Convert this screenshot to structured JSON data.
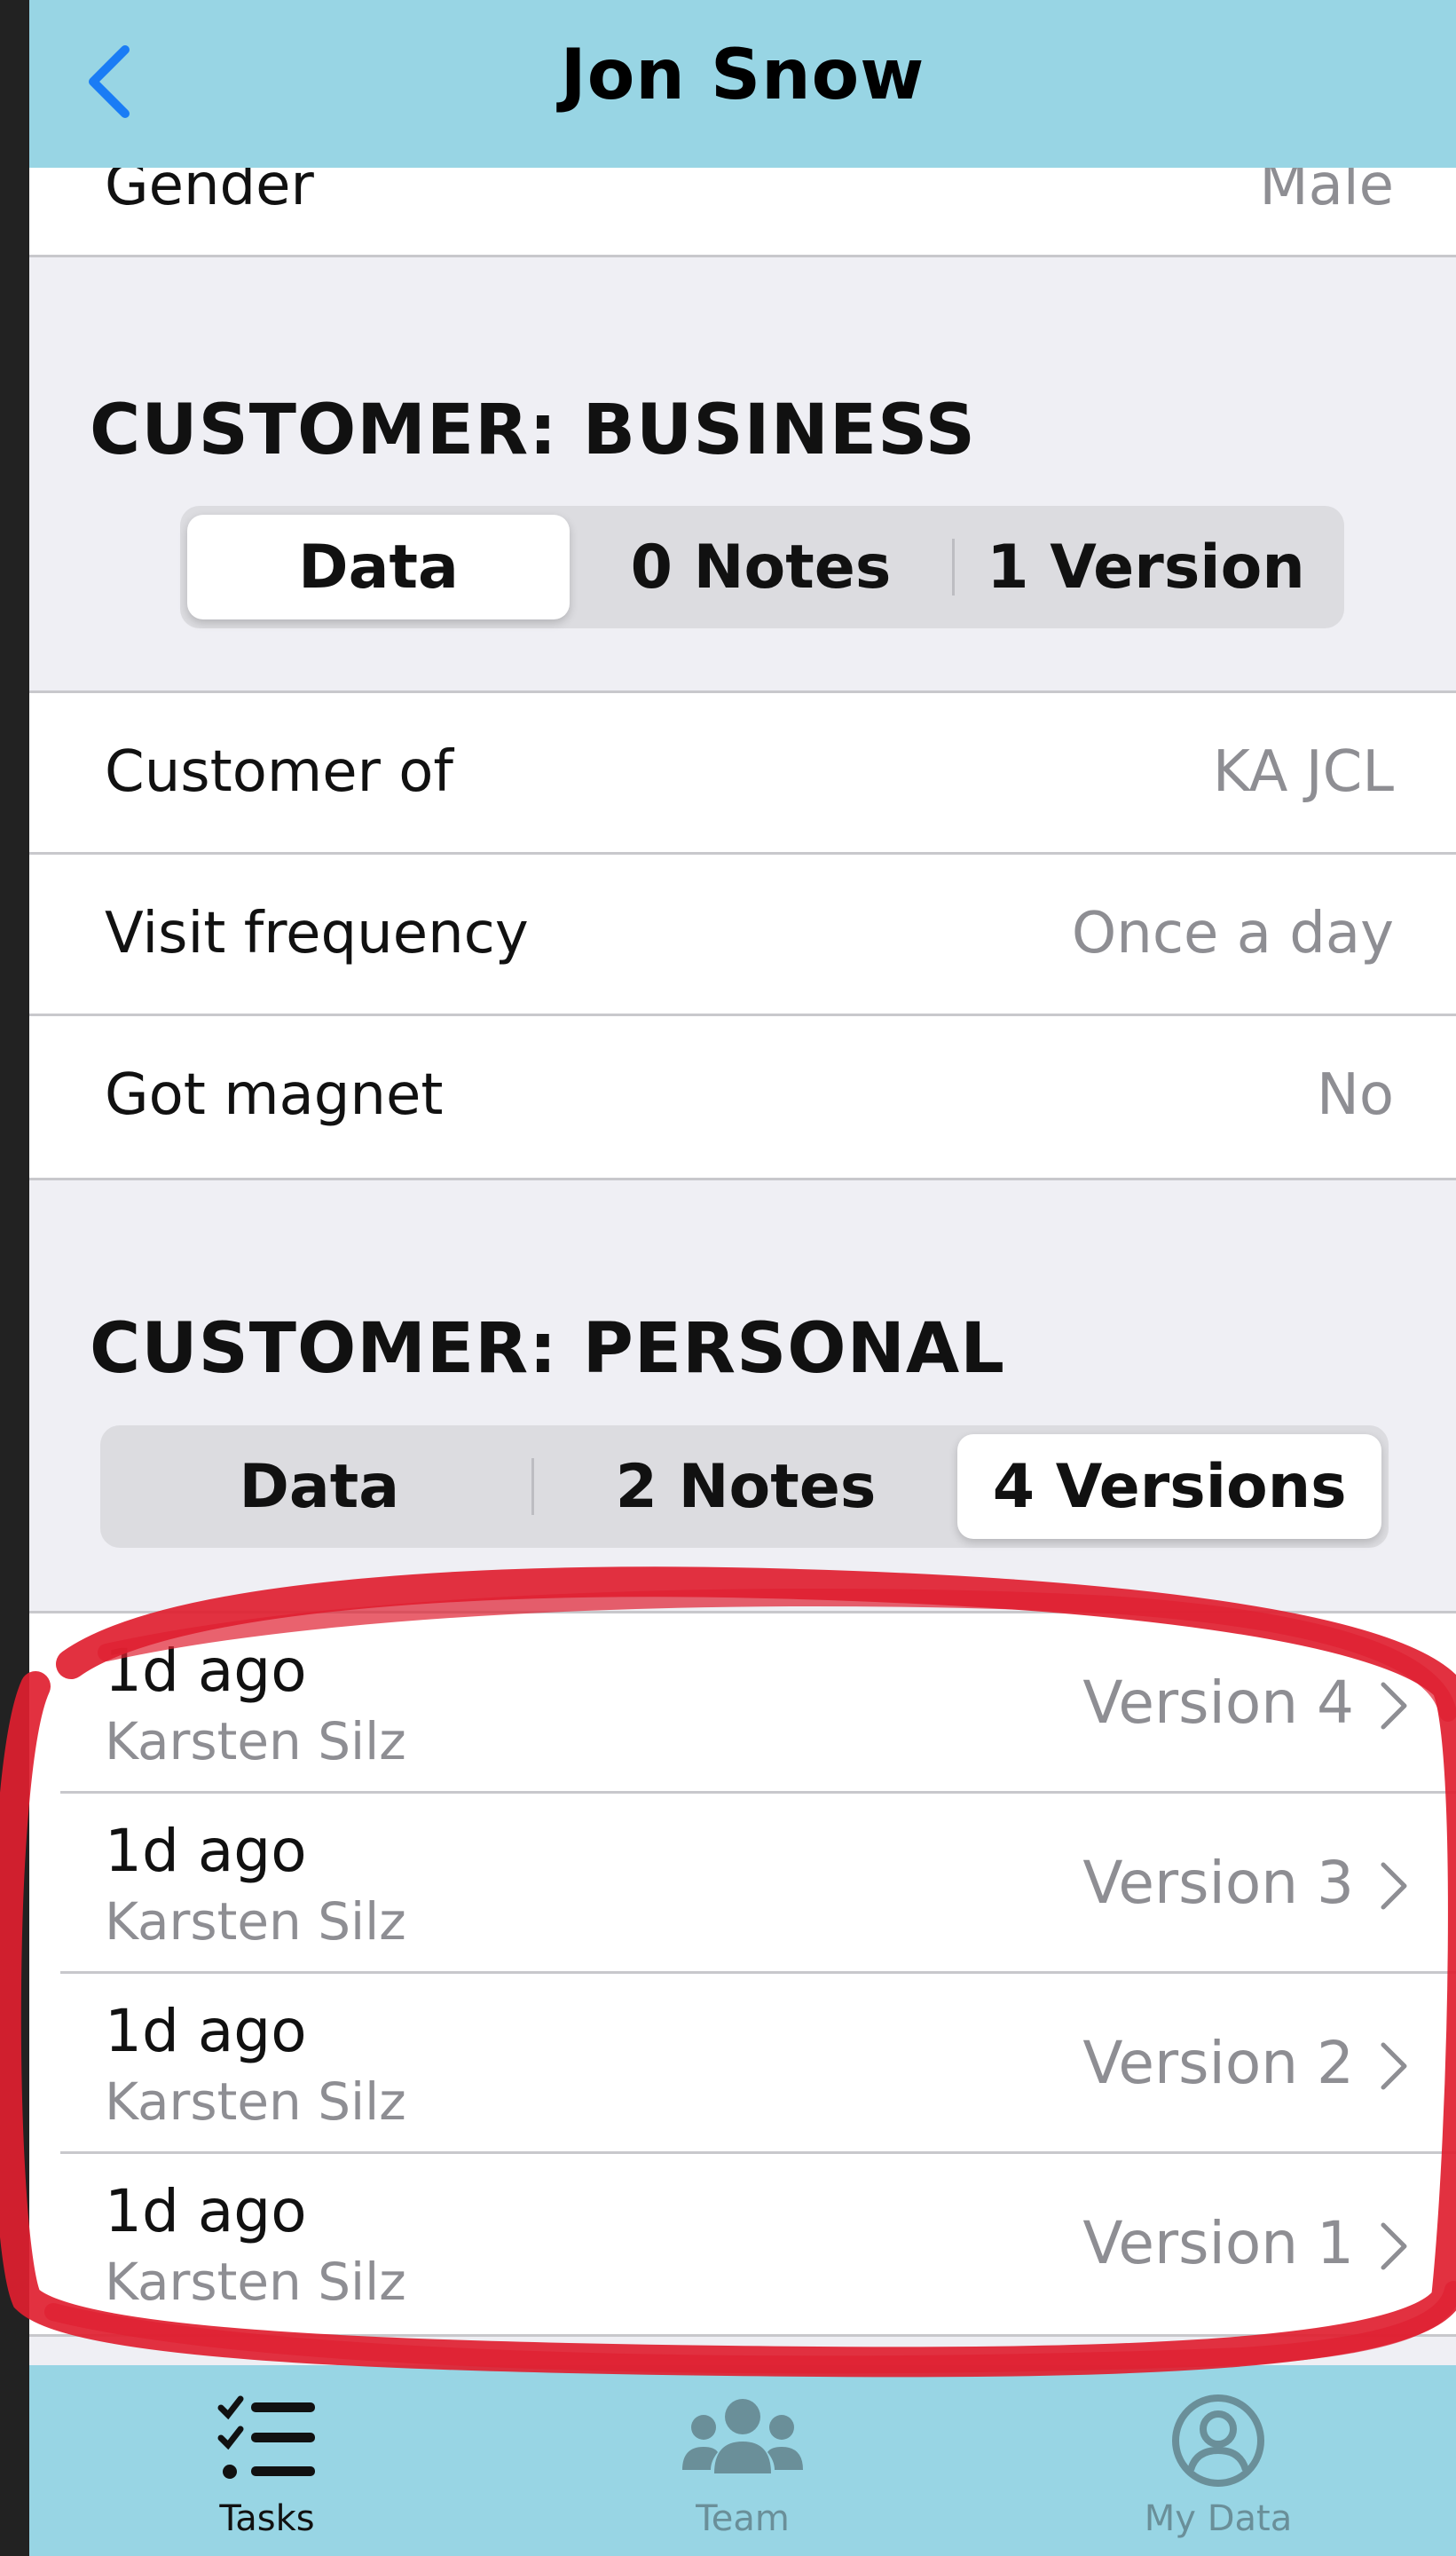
{
  "nav": {
    "title": "Jon Snow"
  },
  "top_row": {
    "label": "Gender",
    "value": "Male"
  },
  "business": {
    "title": "CUSTOMER: BUSINESS",
    "segments": [
      "Data",
      "0 Notes",
      "1 Version"
    ],
    "selected": "Data",
    "rows": [
      {
        "label": "Customer of",
        "value": "KA JCL"
      },
      {
        "label": "Visit frequency",
        "value": "Once a day"
      },
      {
        "label": "Got magnet",
        "value": "No"
      }
    ]
  },
  "personal": {
    "title": "CUSTOMER: PERSONAL",
    "segments": [
      "Data",
      "2 Notes",
      "4 Versions"
    ],
    "selected": "4 Versions",
    "versions": [
      {
        "time": "1d ago",
        "author": "Karsten Silz",
        "label": "Version 4"
      },
      {
        "time": "1d ago",
        "author": "Karsten Silz",
        "label": "Version 3"
      },
      {
        "time": "1d ago",
        "author": "Karsten Silz",
        "label": "Version 2"
      },
      {
        "time": "1d ago",
        "author": "Karsten Silz",
        "label": "Version 1"
      }
    ]
  },
  "tabbar": {
    "tabs": [
      {
        "label": "Tasks",
        "icon": "tasks-list-icon",
        "active": true
      },
      {
        "label": "Team",
        "icon": "team-icon",
        "active": false
      },
      {
        "label": "My Data",
        "icon": "user-circle-icon",
        "active": false
      }
    ]
  },
  "colors": {
    "bar_background": "#98d5e4",
    "accent_blue": "#1a7cf5",
    "annotation_red": "#e02030"
  }
}
